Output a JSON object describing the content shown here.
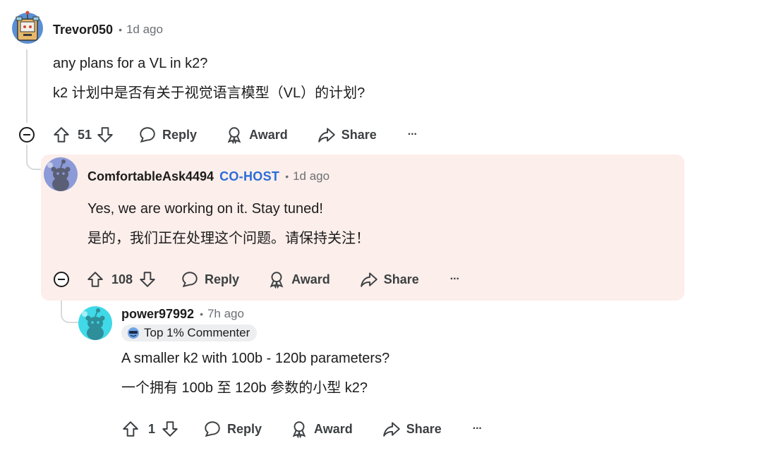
{
  "comments": [
    {
      "author": "Trevor050",
      "separator": "•",
      "time": "1d ago",
      "text_en": "any plans for a VL in k2?",
      "text_zh": "k2 计划中是否有关于视觉语言模型（VL）的计划?",
      "votes": "51",
      "actions": {
        "reply": "Reply",
        "award": "Award",
        "share": "Share",
        "more": "···"
      }
    },
    {
      "author": "ComfortableAsk4494",
      "role": "CO-HOST",
      "separator": "•",
      "time": "1d ago",
      "text_en": "Yes, we are working on it. Stay tuned!",
      "text_zh": "是的，我们正在处理这个问题。请保持关注！",
      "votes": "108",
      "actions": {
        "reply": "Reply",
        "award": "Award",
        "share": "Share",
        "more": "···"
      }
    },
    {
      "author": "power97992",
      "separator": "•",
      "time": "7h ago",
      "badge": "Top 1% Commenter",
      "text_en": "A smaller k2 with 100b - 120b parameters?",
      "text_zh": "一个拥有 100b 至 120b 参数的小型 k2?",
      "votes": "1",
      "actions": {
        "reply": "Reply",
        "award": "Award",
        "share": "Share",
        "more": "···"
      }
    }
  ],
  "colors": {
    "highlight_bg": "#fceeea",
    "cohost": "#2b6cd9",
    "thread_accent": "#e8591a",
    "text": "#1c1c1c",
    "muted": "#6b7075"
  },
  "icons": [
    "avatar-robot-icon",
    "avatar-snoo-icon",
    "upvote-icon",
    "downvote-icon",
    "comment-icon",
    "award-icon",
    "share-icon",
    "collapse-icon",
    "badge-icon"
  ]
}
